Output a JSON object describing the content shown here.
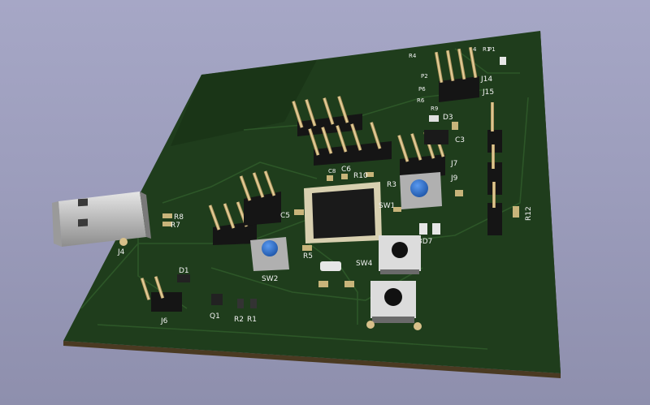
{
  "scene": {
    "kind": "3D PCB viewer render",
    "colors": {
      "background_top": "#a6a7c6",
      "background_bottom": "#8e8fad",
      "board": "#1f3d1c",
      "board_dark": "#183216",
      "board_edge": "#4a3a22",
      "trace": "#2c5128",
      "silkscreen": "#f2f2f2",
      "pin_gold": "#d8c08a",
      "header_body": "#151515",
      "ic_body": "#1a1a1a",
      "switch_cap_blue": "#2a6fd0",
      "switch_body": "#b8b8b8",
      "usb_metal": "#c9c9c9"
    }
  },
  "labels": {
    "usb": "J4",
    "r8": "R8",
    "r7": "R7",
    "d1": "D1",
    "j6": "J6",
    "q1": "Q1",
    "r2": "R2",
    "r1": "R1",
    "sw2": "SW2",
    "c5": "C5",
    "r5": "R5",
    "c8": "C8",
    "c6": "C6",
    "r10": "R10",
    "r3": "R3",
    "sw1": "SW1",
    "sw4": "SW4",
    "sw3_d7": "3D7",
    "j7": "J7",
    "j9": "J9",
    "c3": "C3",
    "d3": "D3",
    "r9": "R9",
    "r6": "R6",
    "j14": "J14",
    "j15": "J15",
    "r12": "R12",
    "top1": "R4",
    "top2": "P2",
    "top3": "P6",
    "top4": "R1",
    "top5": "4",
    "top6": "P1"
  }
}
